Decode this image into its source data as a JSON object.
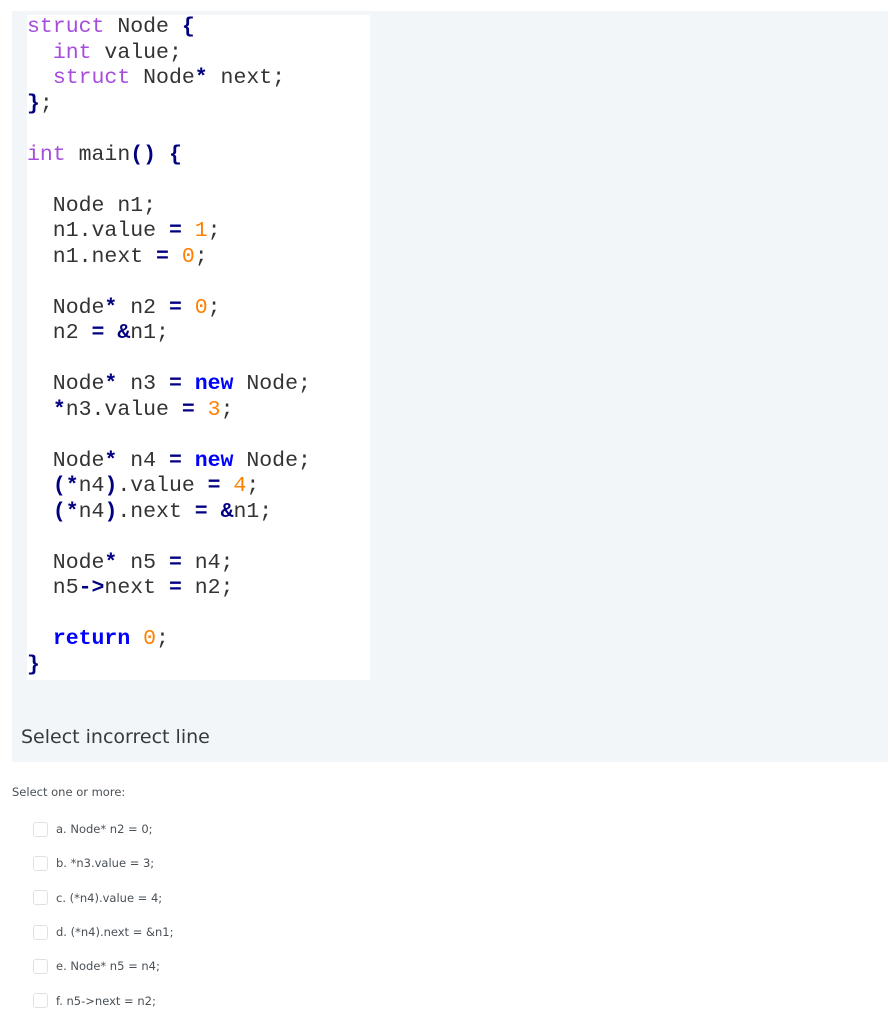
{
  "question": {
    "code_lines": [
      [
        {
          "t": "struct",
          "c": "kw"
        },
        {
          "t": " Node "
        },
        {
          "t": "{",
          "c": "op"
        }
      ],
      [
        {
          "t": "  "
        },
        {
          "t": "int",
          "c": "kw"
        },
        {
          "t": " value;"
        }
      ],
      [
        {
          "t": "  "
        },
        {
          "t": "struct",
          "c": "kw"
        },
        {
          "t": " Node"
        },
        {
          "t": "*",
          "c": "op"
        },
        {
          "t": " next;"
        }
      ],
      [
        {
          "t": "}",
          "c": "op"
        },
        {
          "t": ";"
        }
      ],
      [],
      [
        {
          "t": "int",
          "c": "kw"
        },
        {
          "t": " main"
        },
        {
          "t": "()",
          "c": "op"
        },
        {
          "t": " "
        },
        {
          "t": "{",
          "c": "op"
        }
      ],
      [],
      [
        {
          "t": "  Node n1;"
        }
      ],
      [
        {
          "t": "  n1.value "
        },
        {
          "t": "=",
          "c": "op"
        },
        {
          "t": " "
        },
        {
          "t": "1",
          "c": "num"
        },
        {
          "t": ";"
        }
      ],
      [
        {
          "t": "  n1.next "
        },
        {
          "t": "=",
          "c": "op"
        },
        {
          "t": " "
        },
        {
          "t": "0",
          "c": "num"
        },
        {
          "t": ";"
        }
      ],
      [],
      [
        {
          "t": "  Node"
        },
        {
          "t": "*",
          "c": "op"
        },
        {
          "t": " n2 "
        },
        {
          "t": "=",
          "c": "op"
        },
        {
          "t": " "
        },
        {
          "t": "0",
          "c": "num"
        },
        {
          "t": ";"
        }
      ],
      [
        {
          "t": "  n2 "
        },
        {
          "t": "=",
          "c": "op"
        },
        {
          "t": " "
        },
        {
          "t": "&",
          "c": "op"
        },
        {
          "t": "n1;"
        }
      ],
      [],
      [
        {
          "t": "  Node"
        },
        {
          "t": "*",
          "c": "op"
        },
        {
          "t": " n3 "
        },
        {
          "t": "=",
          "c": "op"
        },
        {
          "t": " "
        },
        {
          "t": "new",
          "c": "kw2"
        },
        {
          "t": " Node;"
        }
      ],
      [
        {
          "t": "  "
        },
        {
          "t": "*",
          "c": "op"
        },
        {
          "t": "n3.value "
        },
        {
          "t": "=",
          "c": "op"
        },
        {
          "t": " "
        },
        {
          "t": "3",
          "c": "num"
        },
        {
          "t": ";"
        }
      ],
      [],
      [
        {
          "t": "  Node"
        },
        {
          "t": "*",
          "c": "op"
        },
        {
          "t": " n4 "
        },
        {
          "t": "=",
          "c": "op"
        },
        {
          "t": " "
        },
        {
          "t": "new",
          "c": "kw2"
        },
        {
          "t": " Node;"
        }
      ],
      [
        {
          "t": "  "
        },
        {
          "t": "(*",
          "c": "op"
        },
        {
          "t": "n4"
        },
        {
          "t": ")",
          "c": "op"
        },
        {
          "t": ".value "
        },
        {
          "t": "=",
          "c": "op"
        },
        {
          "t": " "
        },
        {
          "t": "4",
          "c": "num"
        },
        {
          "t": ";"
        }
      ],
      [
        {
          "t": "  "
        },
        {
          "t": "(*",
          "c": "op"
        },
        {
          "t": "n4"
        },
        {
          "t": ")",
          "c": "op"
        },
        {
          "t": ".next "
        },
        {
          "t": "=",
          "c": "op"
        },
        {
          "t": " "
        },
        {
          "t": "&",
          "c": "op"
        },
        {
          "t": "n1;"
        }
      ],
      [],
      [
        {
          "t": "  Node"
        },
        {
          "t": "*",
          "c": "op"
        },
        {
          "t": " n5 "
        },
        {
          "t": "=",
          "c": "op"
        },
        {
          "t": " n4;"
        }
      ],
      [
        {
          "t": "  n5"
        },
        {
          "t": "->",
          "c": "op"
        },
        {
          "t": "next "
        },
        {
          "t": "=",
          "c": "op"
        },
        {
          "t": " n2;"
        }
      ],
      [],
      [
        {
          "t": "  "
        },
        {
          "t": "return",
          "c": "kw2"
        },
        {
          "t": " "
        },
        {
          "t": "0",
          "c": "num"
        },
        {
          "t": ";"
        }
      ],
      [
        {
          "t": "}",
          "c": "op"
        }
      ]
    ],
    "prompt": "Select incorrect line"
  },
  "answer": {
    "instruction": "Select one or more:",
    "options": [
      {
        "label": "a. Node* n2 = 0;",
        "checked": false
      },
      {
        "label": "b. *n3.value = 3;",
        "checked": false
      },
      {
        "label": "c. (*n4).value = 4;",
        "checked": false
      },
      {
        "label": "d. (*n4).next = &n1;",
        "checked": false
      },
      {
        "label": "e. Node* n5 = n4;",
        "checked": false
      },
      {
        "label": "f. n5->next = n2;",
        "checked": false
      }
    ]
  }
}
